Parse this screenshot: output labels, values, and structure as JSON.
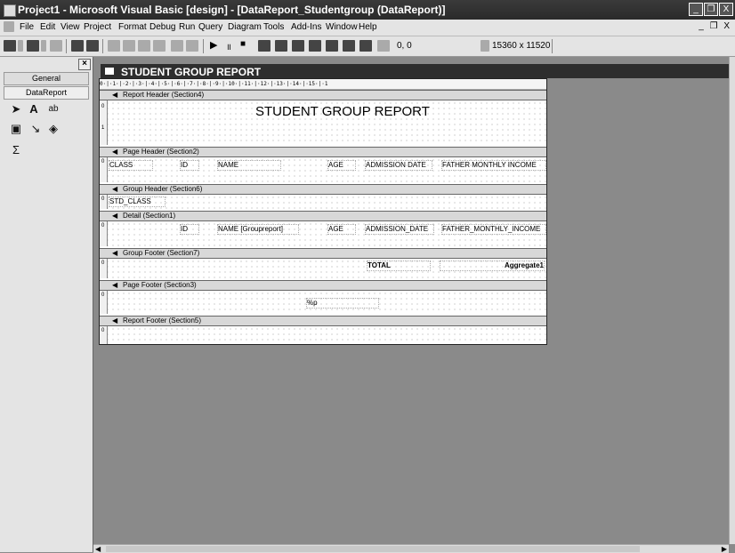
{
  "window": {
    "title": "Project1 - Microsoft Visual Basic [design] - [DataReport_Studentgroup (DataReport)]",
    "controls": [
      "_",
      "❐",
      "X"
    ]
  },
  "menu": {
    "items": [
      "File",
      "Edit",
      "View",
      "Project",
      "Format",
      "Debug",
      "Run",
      "Query",
      "Diagram",
      "Tools",
      "Add-Ins",
      "Window",
      "Help"
    ],
    "mdi_controls": "_ ❐ X"
  },
  "toolbar": {
    "position": "0, 0",
    "size": "15360 x 11520"
  },
  "toolbox": {
    "tabs": [
      "General",
      "DataReport"
    ],
    "tools": [
      "pointer-icon",
      "label-icon",
      "textbox-icon",
      "image-icon",
      "line-icon",
      "shape-icon",
      "function-icon"
    ]
  },
  "designer": {
    "window_title": "STUDENT GROUP REPORT",
    "ruler": "0·|·1·|·2·|·3·|·4·|·5·|·6·|·7·|·8·|·9·|·10·|·11·|·12·|·13·|·14·|·15·|·1",
    "sections": {
      "report_header": "Report Header (Section4)",
      "page_header": "Page Header (Section2)",
      "group_header": "Group Header (Section6)",
      "detail": "Detail (Section1)",
      "group_footer": "Group Footer (Section7)",
      "page_footer": "Page Footer (Section3)",
      "report_footer": "Report Footer (Section5)"
    },
    "report_title": "STUDENT GROUP REPORT",
    "page_header_fields": [
      "CLASS",
      "ID",
      "NAME",
      "AGE",
      "ADMISSION DATE",
      "FATHER MONTHLY INCOME"
    ],
    "group_header_field": "STD_CLASS",
    "detail_fields": [
      "ID",
      "NAME [Groupreport]",
      "AGE",
      "ADMISSION_DATE",
      "FATHER_MONTHLY_INCOME"
    ],
    "group_footer_total": "TOTAL",
    "group_footer_aggregate": "Aggregate1",
    "page_footer_field": "%p"
  }
}
